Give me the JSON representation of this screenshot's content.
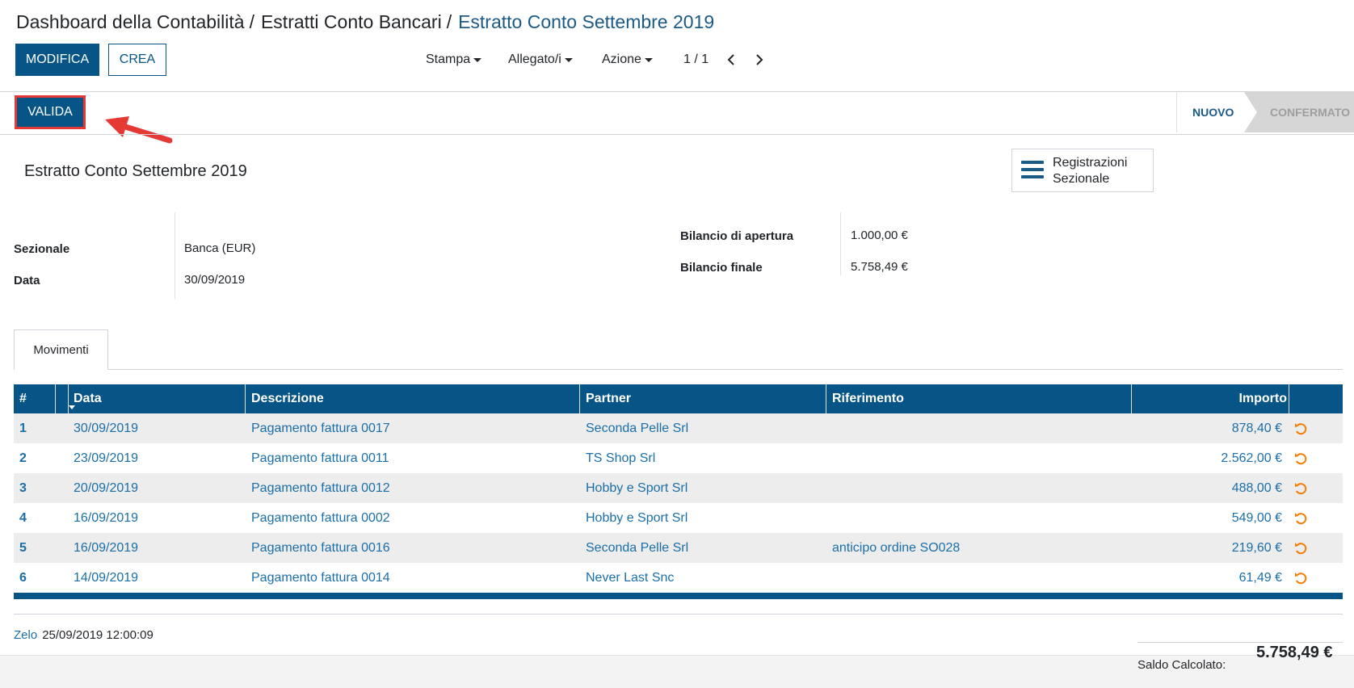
{
  "breadcrumb": {
    "items": [
      "Dashboard della Contabilità",
      "Estratti Conto Bancari"
    ],
    "current": "Estratto Conto Settembre 2019",
    "separator": "/"
  },
  "toolbar": {
    "edit_label": "MODIFICA",
    "create_label": "CREA",
    "print_label": "Stampa",
    "attachments_label": "Allegato/i",
    "action_label": "Azione",
    "pager": "1 / 1"
  },
  "statusbar": {
    "validate_label": "VALIDA",
    "stages": [
      "NUOVO",
      "CONFERMATO"
    ]
  },
  "record": {
    "title": "Estratto Conto Settembre 2019",
    "smart_button": {
      "line1": "Registrazioni",
      "line2": "Sezionale"
    },
    "fields_left": [
      {
        "label": "Sezionale",
        "value": "Banca (EUR)"
      },
      {
        "label": "Data",
        "value": "30/09/2019"
      }
    ],
    "fields_right": [
      {
        "label": "Bilancio di apertura",
        "value": "1.000,00 €"
      },
      {
        "label": "Bilancio finale",
        "value": "5.758,49 €"
      }
    ]
  },
  "tabs": [
    {
      "label": "Movimenti"
    }
  ],
  "table": {
    "columns": [
      "#",
      "Data",
      "Descrizione",
      "Partner",
      "Riferimento",
      "Importo"
    ],
    "rows": [
      {
        "n": "1",
        "date": "30/09/2019",
        "desc": "Pagamento fattura 0017",
        "partner": "Seconda Pelle Srl",
        "ref": "",
        "amount": "878,40 €"
      },
      {
        "n": "2",
        "date": "23/09/2019",
        "desc": "Pagamento fattura 0011",
        "partner": "TS Shop Srl",
        "ref": "",
        "amount": "2.562,00 €"
      },
      {
        "n": "3",
        "date": "20/09/2019",
        "desc": "Pagamento fattura 0012",
        "partner": "Hobby e Sport Srl",
        "ref": "",
        "amount": "488,00 €"
      },
      {
        "n": "4",
        "date": "16/09/2019",
        "desc": "Pagamento fattura 0002",
        "partner": "Hobby e Sport Srl",
        "ref": "",
        "amount": "549,00 €"
      },
      {
        "n": "5",
        "date": "16/09/2019",
        "desc": "Pagamento fattura 0016",
        "partner": "Seconda Pelle Srl",
        "ref": "anticipo ordine SO028",
        "amount": "219,60 €"
      },
      {
        "n": "6",
        "date": "14/09/2019",
        "desc": "Pagamento fattura 0014",
        "partner": "Never Last Snc",
        "ref": "",
        "amount": "61,49 €"
      }
    ]
  },
  "footer": {
    "author": "Zelo",
    "timestamp": "25/09/2019 12:00:09",
    "total_label": "Saldo Calcolato:",
    "total_value": "5.758,49 €"
  },
  "colors": {
    "primary": "#075487",
    "link": "#1b6fa8",
    "highlight_border": "#e53935",
    "undo_icon": "#f57c00"
  }
}
